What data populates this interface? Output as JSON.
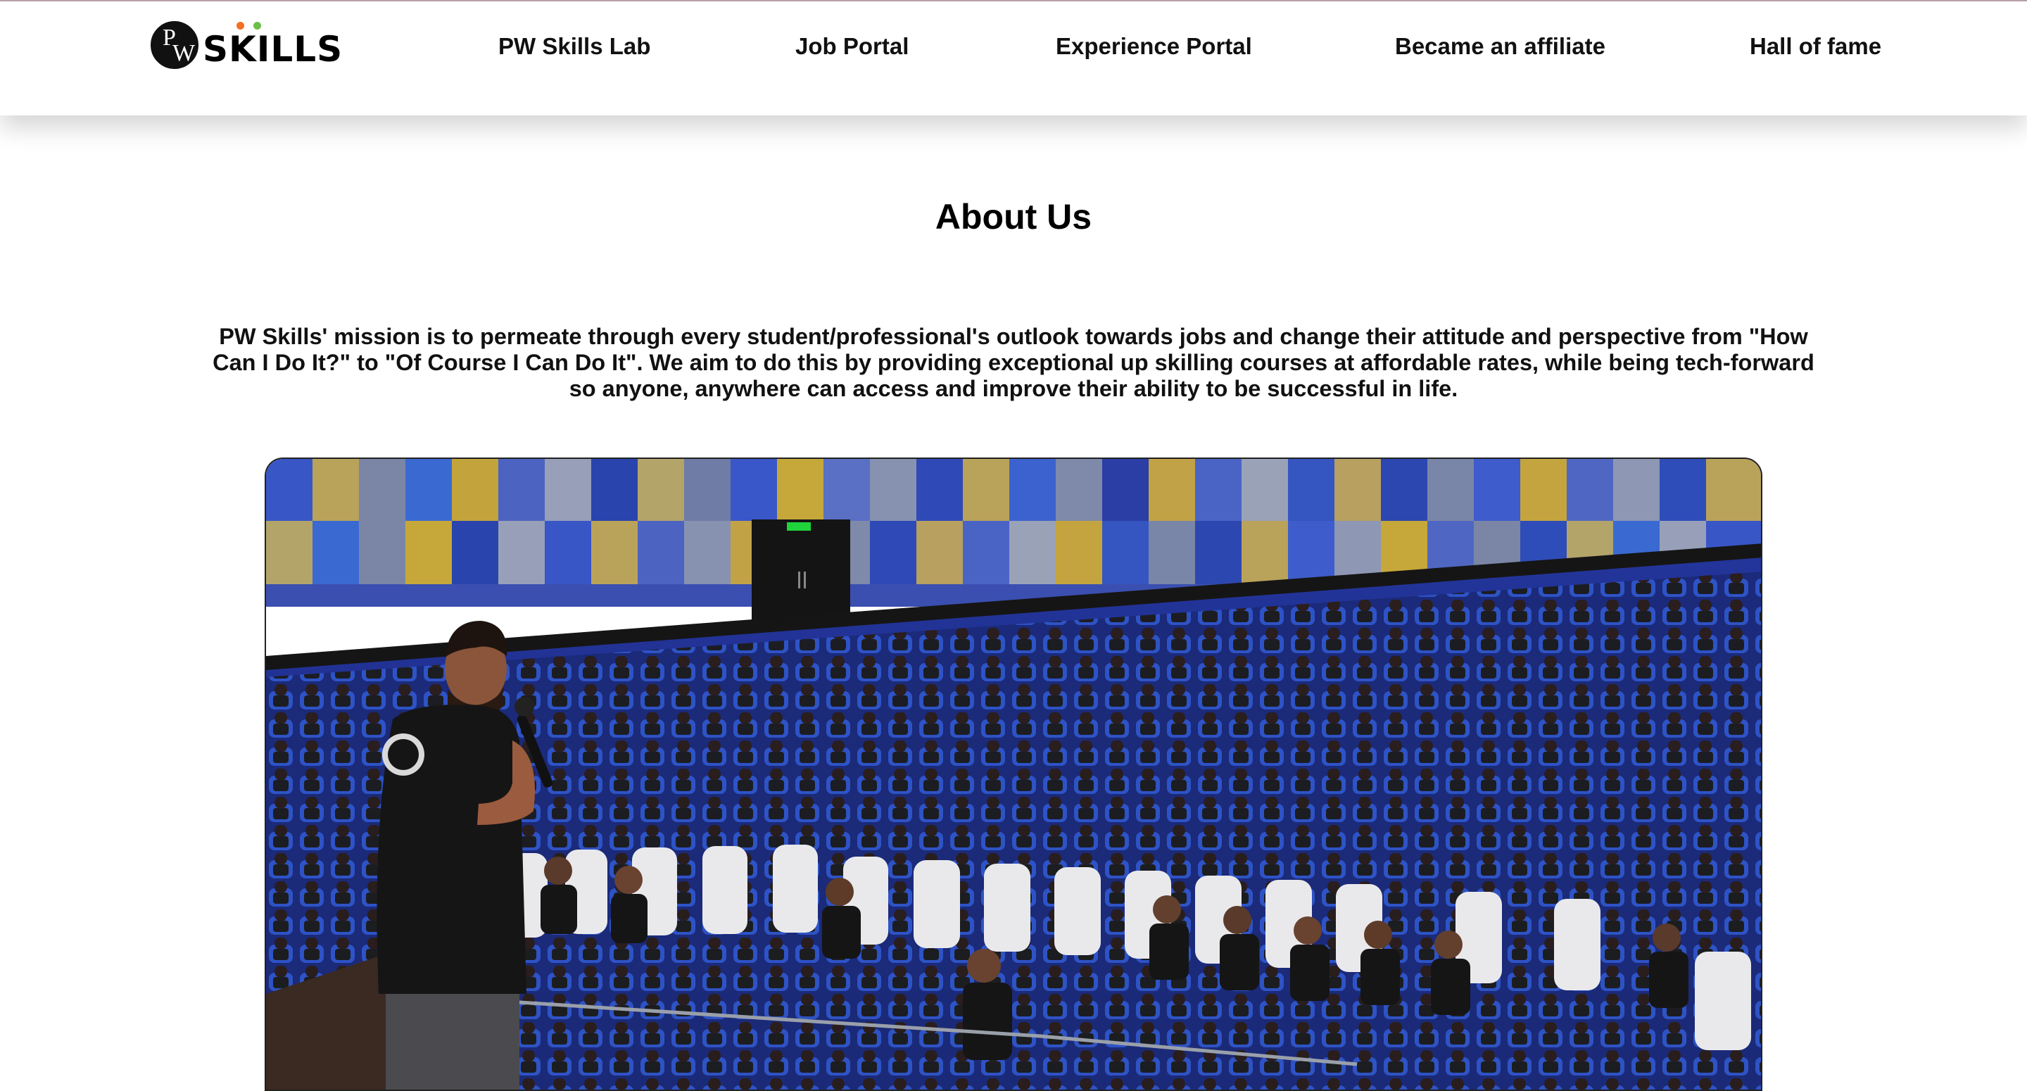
{
  "brand": {
    "name": "SKILLS",
    "badge_text": "PW",
    "dot_colors": [
      "#f36f21",
      "#6cc04a"
    ]
  },
  "nav": {
    "items": [
      {
        "label": "PW Skills Lab"
      },
      {
        "label": "Job Portal"
      },
      {
        "label": "Experience Portal"
      },
      {
        "label": "Became an affiliate"
      },
      {
        "label": "Hall of fame"
      }
    ]
  },
  "about": {
    "title": "About Us",
    "mission": "PW Skills' mission is to permeate through every student/professional's outlook towards jobs and change their attitude and perspective from \"How Can I Do It?\" to \"Of Course I Can Do It\". We aim to do this by providing exceptional up skilling courses at affordable rates, while being tech-forward so anyone, anywhere can access and improve their ability to be successful in life."
  },
  "colors": {
    "topline": "#b9a3aa",
    "seat_blue": "#2f55c9",
    "wall_blue": "#3a58c8",
    "wall_gold": "#b9a35a",
    "shirt_black": "#151515",
    "exit_green": "#1fd43a"
  }
}
